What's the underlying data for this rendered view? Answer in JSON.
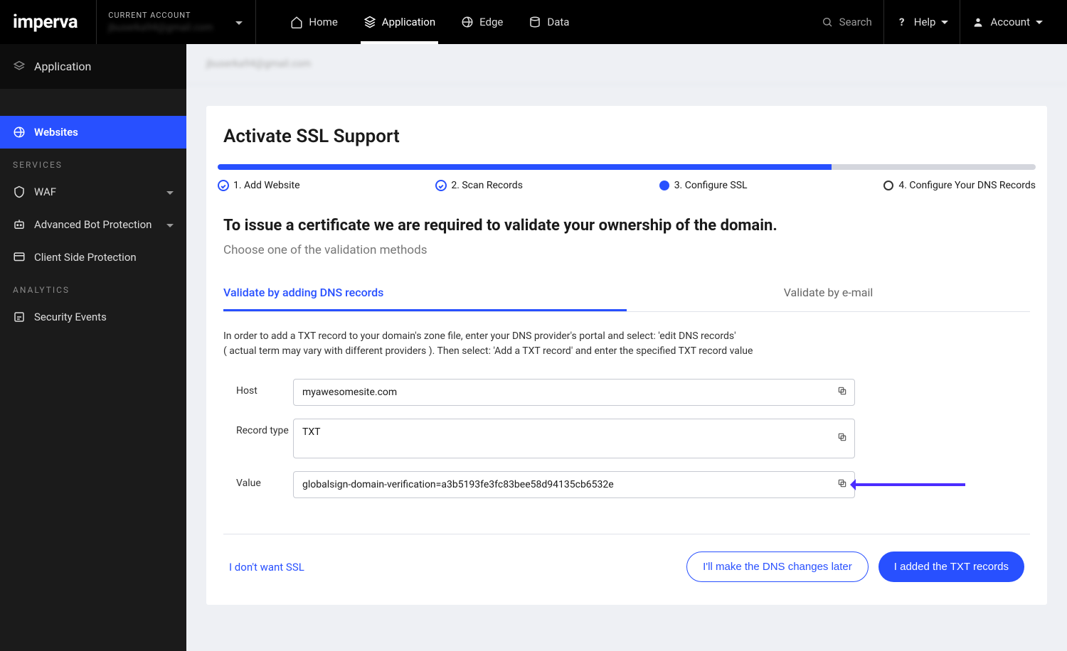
{
  "brand": "imperva",
  "account_selector": {
    "label": "CURRENT ACCOUNT",
    "value": "jbuserka94@gmail.com"
  },
  "topnav": {
    "items": [
      {
        "id": "home",
        "label": "Home"
      },
      {
        "id": "application",
        "label": "Application",
        "active": true
      },
      {
        "id": "edge",
        "label": "Edge"
      },
      {
        "id": "data",
        "label": "Data"
      }
    ],
    "search": "Search",
    "help": "Help",
    "account": "Account"
  },
  "sidebar": {
    "header": "Application",
    "active": "Websites",
    "sections": [
      {
        "title": "",
        "items": [
          {
            "id": "websites",
            "label": "Websites",
            "active": true
          }
        ]
      },
      {
        "title": "SERVICES",
        "items": [
          {
            "id": "waf",
            "label": "WAF",
            "expandable": true
          },
          {
            "id": "abp",
            "label": "Advanced Bot Protection",
            "expandable": true
          },
          {
            "id": "csp",
            "label": "Client Side Protection"
          }
        ]
      },
      {
        "title": "ANALYTICS",
        "items": [
          {
            "id": "sec-events",
            "label": "Security Events"
          }
        ]
      }
    ]
  },
  "breadcrumb": "jbuserka94@gmail.com",
  "page": {
    "title": "Activate SSL Support",
    "progress_percent": 75,
    "steps": [
      {
        "state": "done",
        "label": "1. Add Website"
      },
      {
        "state": "done",
        "label": "2. Scan Records"
      },
      {
        "state": "current",
        "label": "3. Configure SSL"
      },
      {
        "state": "pending",
        "label": "4. Configure Your DNS Records"
      }
    ],
    "heading": "To issue a certificate we are required to validate your ownership of the domain.",
    "subheading": "Choose one of the validation methods",
    "tabs": [
      {
        "id": "dns",
        "label": "Validate by adding DNS records",
        "active": true
      },
      {
        "id": "email",
        "label": "Validate by e-mail"
      }
    ],
    "instructions_line1": "In order to add a TXT record to your domain's zone file, enter your DNS provider's portal and select: 'edit DNS records'",
    "instructions_line2": "( actual term may vary with different providers ). Then select: 'Add a TXT record' and enter the specified TXT record value",
    "fields": {
      "host": {
        "label": "Host",
        "value": "myawesomesite.com"
      },
      "record_type": {
        "label": "Record type",
        "value": "TXT"
      },
      "value": {
        "label": "Value",
        "value": "globalsign-domain-verification=a3b5193fe3fc83bee58d94135cb6532e"
      }
    },
    "footer": {
      "skip": "I don't want SSL",
      "later": "I'll make the DNS changes later",
      "done": "I added the TXT records"
    }
  },
  "colors": {
    "primary": "#2850ff"
  }
}
